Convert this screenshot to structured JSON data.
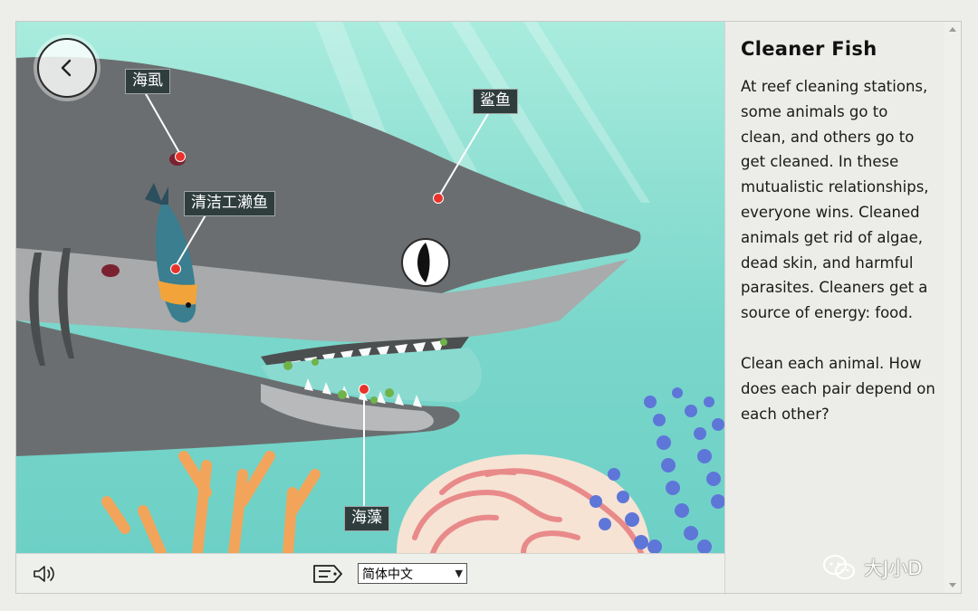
{
  "scene": {
    "labels": {
      "sea_louse": "海虱",
      "shark": "鲨鱼",
      "cleaner_wrasse": "清洁工濑鱼",
      "seaweed": "海藻"
    }
  },
  "toolbar": {
    "back_icon": "chevron-left-icon",
    "sound_icon": "speaker-icon",
    "caption_icon": "tag-icon",
    "language_selected": "简体中文"
  },
  "panel": {
    "title": "Cleaner Fish",
    "paragraph1": "At reef cleaning stations, some animals go to clean, and others go to get cleaned. In these mutualistic relationships, everyone wins. Cleaned animals get rid of algae, dead skin, and harmful parasites. Cleaners get a source of energy: food.",
    "paragraph2": "Clean each animal. How does each pair depend on each other?"
  },
  "watermark": {
    "text": "大J小D"
  },
  "colors": {
    "water": "#8fe0d3",
    "shark": "#6b6f70",
    "label_bg": "#2f3d3d",
    "hotspot": "#e8332c",
    "panel_bg": "#ecece8"
  }
}
